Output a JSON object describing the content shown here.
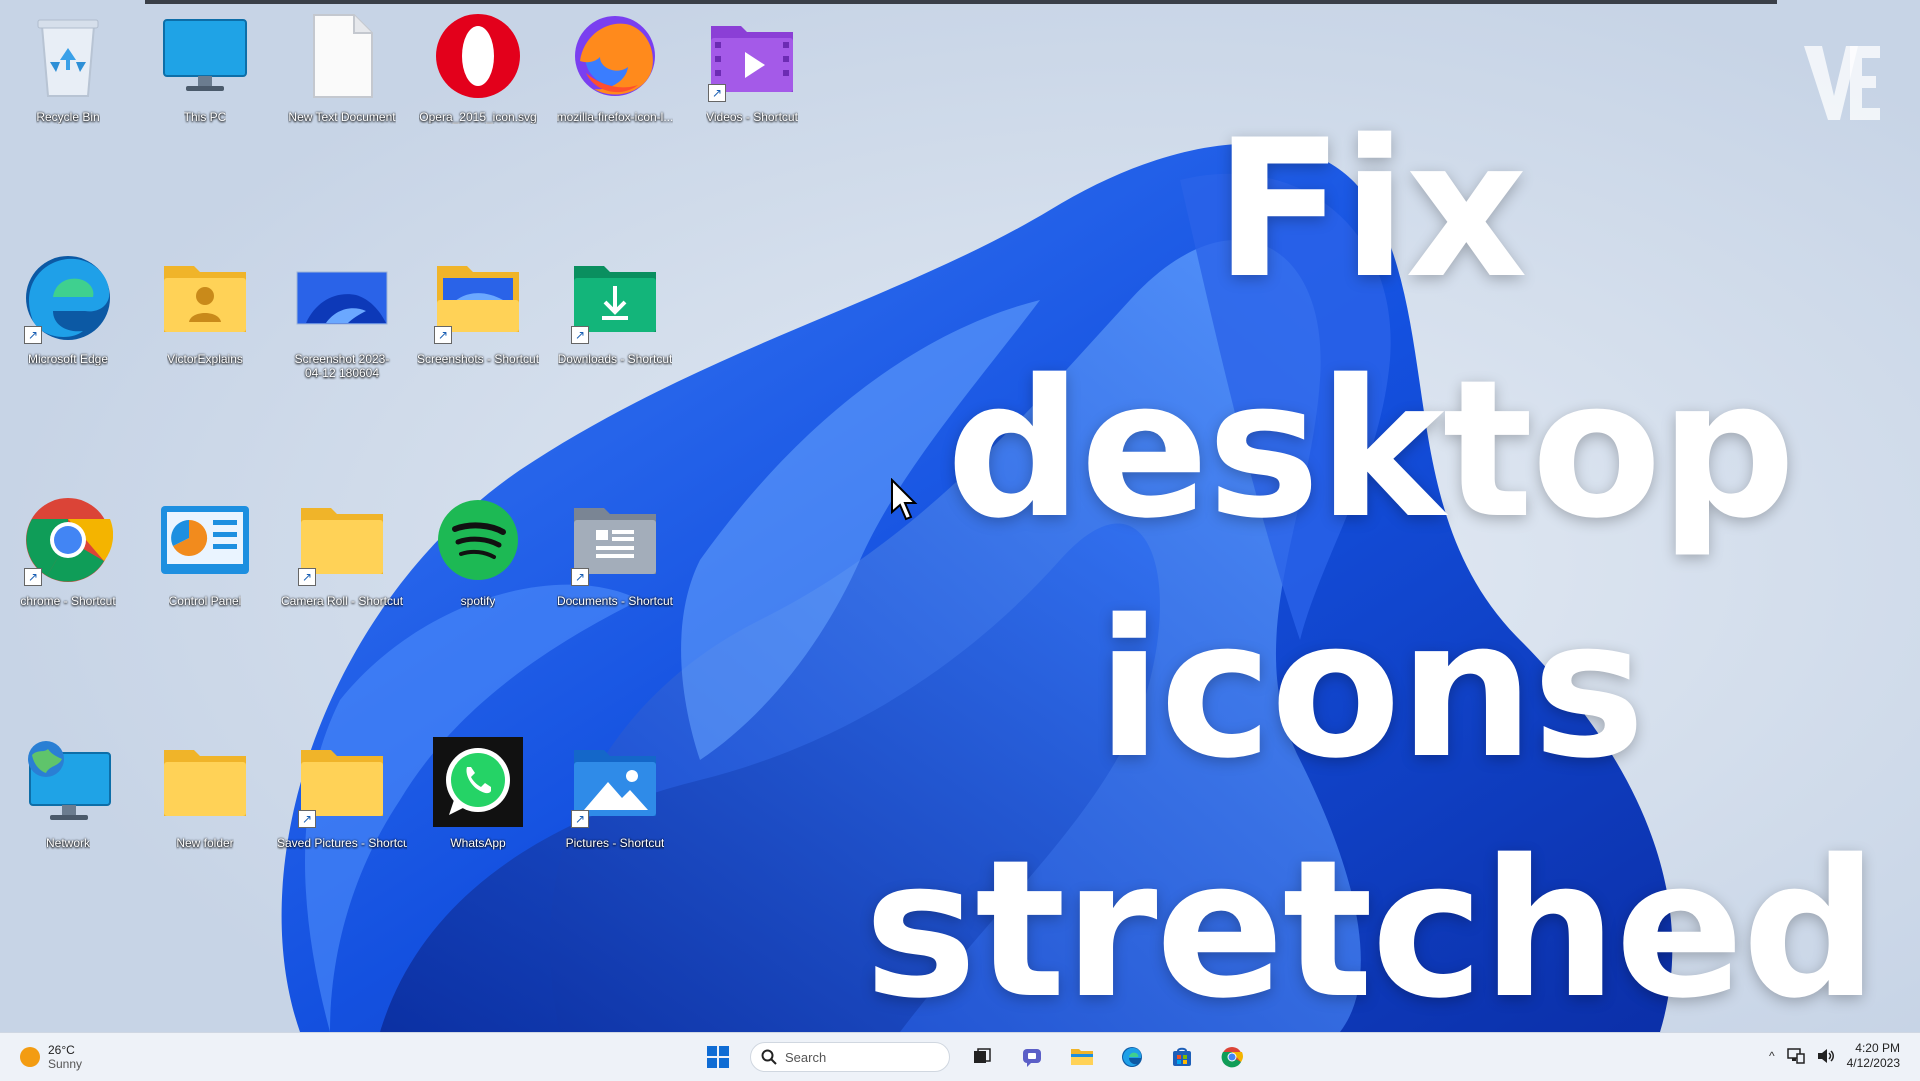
{
  "overlay": {
    "line1": "Fix",
    "line2": "desktop",
    "line3": "icons",
    "line4": "stretched"
  },
  "desktop_icons": [
    {
      "label": "Recycle Bin",
      "icon": "recycle-bin-icon"
    },
    {
      "label": "This PC",
      "icon": "monitor-icon"
    },
    {
      "label": "New Text Document",
      "icon": "text-document-icon"
    },
    {
      "label": "Opera_2015_icon.svg",
      "icon": "opera-icon"
    },
    {
      "label": "mozilla-firefox-icon-l...",
      "icon": "firefox-icon"
    },
    {
      "label": "Videos - Shortcut",
      "icon": "videos-folder-icon"
    },
    {
      "label": "Microsoft Edge",
      "icon": "edge-icon"
    },
    {
      "label": "VictorExplains",
      "icon": "user-folder-icon"
    },
    {
      "label": "Screenshot 2023-04-12 180604",
      "icon": "image-thumbnail-icon"
    },
    {
      "label": "Screenshots - Shortcut",
      "icon": "screenshots-folder-icon"
    },
    {
      "label": "Downloads - Shortcut",
      "icon": "downloads-folder-icon"
    },
    {
      "label": "chrome - Shortcut",
      "icon": "chrome-icon"
    },
    {
      "label": "Control Panel",
      "icon": "control-panel-icon"
    },
    {
      "label": "Camera Roll - Shortcut",
      "icon": "folder-icon"
    },
    {
      "label": "spotify",
      "icon": "spotify-icon"
    },
    {
      "label": "Documents - Shortcut",
      "icon": "documents-folder-icon"
    },
    {
      "label": "Network",
      "icon": "network-icon"
    },
    {
      "label": "New folder",
      "icon": "folder-icon"
    },
    {
      "label": "Saved Pictures - Shortcut",
      "icon": "folder-icon"
    },
    {
      "label": "WhatsApp",
      "icon": "whatsapp-icon"
    },
    {
      "label": "Pictures - Shortcut",
      "icon": "pictures-folder-icon"
    }
  ],
  "taskbar": {
    "weather": {
      "temp": "26°C",
      "condition": "Sunny"
    },
    "search_placeholder": "Search",
    "clock": {
      "time": "4:20 PM",
      "date": "4/12/2023"
    }
  },
  "colors": {
    "wallpaper_blue": "#1a56e8",
    "taskbar_bg": "#eef2f8"
  }
}
